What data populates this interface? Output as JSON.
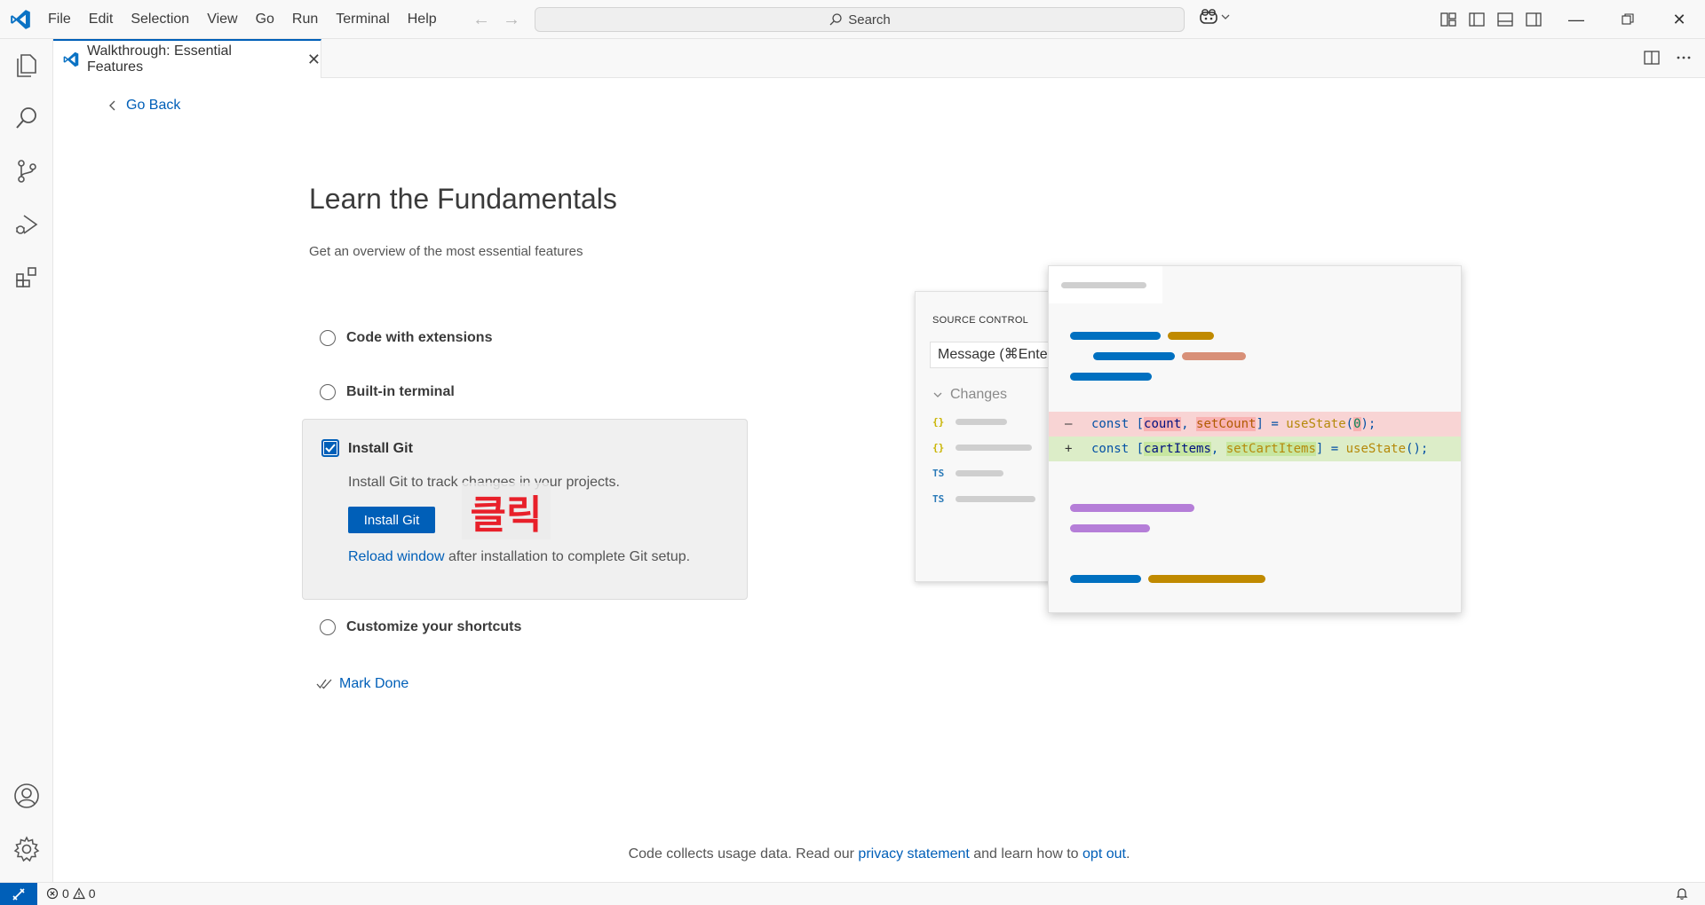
{
  "titlebar": {
    "menu": [
      "File",
      "Edit",
      "Selection",
      "View",
      "Go",
      "Run",
      "Terminal",
      "Help"
    ],
    "search_label": "Search",
    "nav_back_icon": "arrow-left-icon",
    "nav_forward_icon": "arrow-right-icon"
  },
  "tab": {
    "title": "Walkthrough: Essential Features",
    "close": "✕"
  },
  "walkthrough": {
    "go_back": "Go Back",
    "title": "Learn the Fundamentals",
    "subtitle": "Get an overview of the most essential features",
    "steps": [
      {
        "label": "Code with extensions",
        "checked": false
      },
      {
        "label": "Built-in terminal",
        "checked": false
      },
      {
        "label": "Install Git",
        "checked": true
      },
      {
        "label": "Customize your shortcuts",
        "checked": false
      }
    ],
    "active_step": {
      "title": "Install Git",
      "description": "Install Git to track changes in your projects.",
      "button": "Install Git",
      "reload_link": "Reload window",
      "reload_rest": " after installation to complete Git setup."
    },
    "overlay_label": "클릭",
    "mark_done": "Mark Done"
  },
  "illustration": {
    "source_control_title": "SOURCE CONTROL",
    "message_placeholder": "Message (⌘Ente",
    "changes_label": "Changes",
    "file_icons": [
      "{}",
      "{}",
      "TS",
      "TS"
    ],
    "diff_removed": {
      "sign": "—",
      "parts": [
        "const [",
        "count",
        ", ",
        "setCount",
        "] = ",
        "useState",
        "(",
        "0",
        ");"
      ]
    },
    "diff_added": {
      "sign": "+",
      "parts": [
        "const [",
        "cartItems",
        ", ",
        "setCartItems",
        "] = ",
        "useState",
        "();"
      ]
    }
  },
  "footer": {
    "prefix": "Code collects usage data. Read our ",
    "privacy_link": "privacy statement",
    "middle": " and learn how to ",
    "optout_link": "opt out",
    "suffix": "."
  },
  "statusbar": {
    "errors": "0",
    "warnings": "0"
  },
  "colors": {
    "accent": "#005fb8",
    "diff_removed_bg": "#f8d4d4",
    "diff_added_bg": "#dcedc8",
    "overlay_text": "#e8202a"
  }
}
